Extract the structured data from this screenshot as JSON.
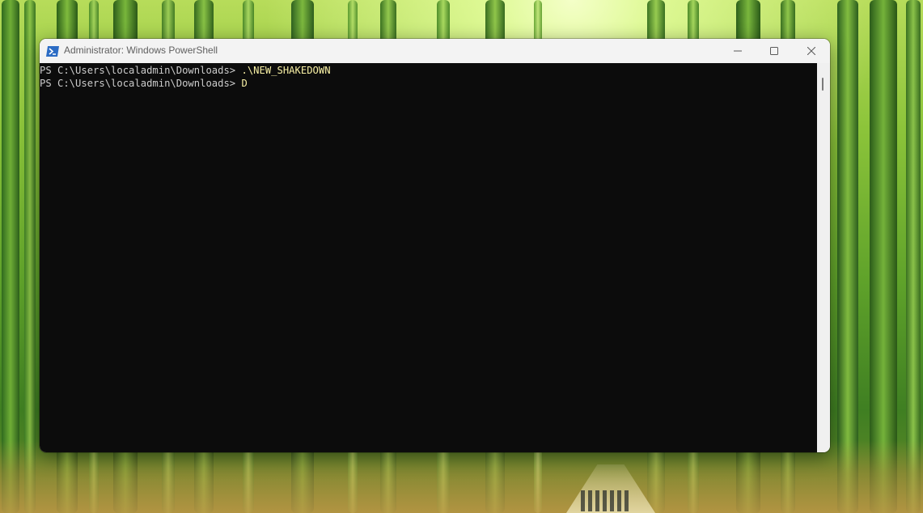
{
  "window": {
    "title": "Administrator: Windows PowerShell",
    "icon": "powershell-icon",
    "controls": {
      "minimize_icon": "minimize-icon",
      "maximize_icon": "maximize-icon",
      "close_icon": "close-icon"
    }
  },
  "console": {
    "lines": [
      {
        "prompt": "PS C:\\Users\\localadmin\\Downloads> ",
        "command": ".\\NEW_SHAKEDOWN"
      },
      {
        "prompt": "PS C:\\Users\\localadmin\\Downloads> ",
        "command": "D"
      }
    ]
  },
  "colors": {
    "console_background": "#0c0c0c",
    "console_text": "#cccccc",
    "command_text": "#f9f1a5",
    "titlebar": "#f3f3f3",
    "powershell_icon_blue": "#2c6cc4"
  },
  "desktop": {
    "wallpaper": "bamboo-forest"
  }
}
